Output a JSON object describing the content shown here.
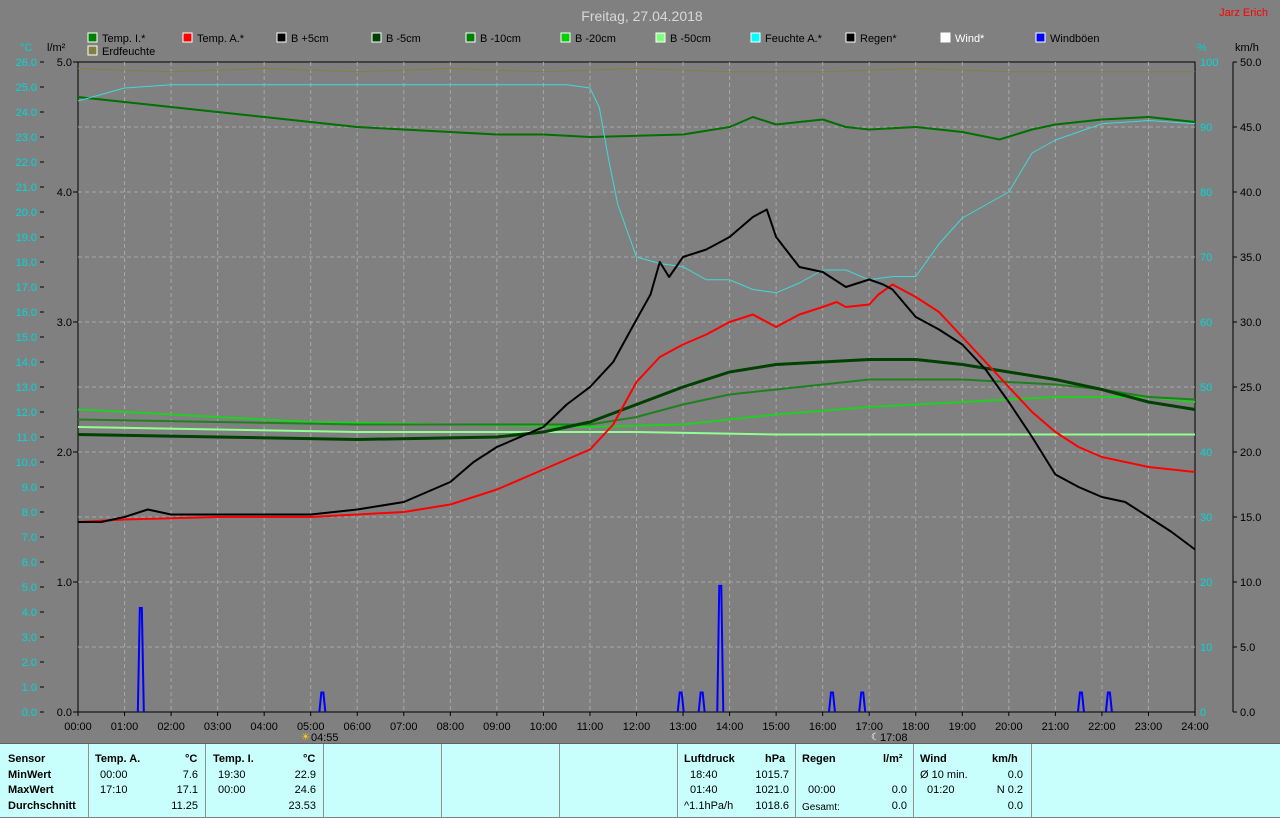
{
  "header": {
    "title": "Freitag, 27.04.2018",
    "author": "Jarz Erich"
  },
  "legend": [
    {
      "label": "Temp. I.*",
      "color": "#008000"
    },
    {
      "label": "Temp. A.*",
      "color": "#ff0000"
    },
    {
      "label": "B +5cm",
      "color": "#000000"
    },
    {
      "label": "B -5cm",
      "color": "#004000"
    },
    {
      "label": "B -10cm",
      "color": "#008000"
    },
    {
      "label": "B -20cm",
      "color": "#00d000"
    },
    {
      "label": "B -50cm",
      "color": "#80ff80"
    },
    {
      "label": "Feuchte A.*",
      "color": "#00ffff"
    },
    {
      "label": "Regen*",
      "color": "#000000"
    },
    {
      "label": "Wind*",
      "color": "#ffffff"
    },
    {
      "label": "Windböen",
      "color": "#0000ff"
    },
    {
      "label": "Erdfeuchte",
      "color": "#808040"
    }
  ],
  "axis_units": {
    "temp": "°C",
    "rain": "l/m²",
    "humidity": "%",
    "wind": "km/h"
  },
  "markers": {
    "sunrise": "04:55",
    "sunset": "17:08"
  },
  "chart_data": {
    "type": "line",
    "x_unit": "hour",
    "xlim": [
      0,
      24
    ],
    "x_ticks": [
      "00:00",
      "01:00",
      "02:00",
      "03:00",
      "04:00",
      "05:00",
      "06:00",
      "07:00",
      "08:00",
      "09:00",
      "10:00",
      "11:00",
      "12:00",
      "13:00",
      "14:00",
      "15:00",
      "16:00",
      "17:00",
      "18:00",
      "19:00",
      "20:00",
      "21:00",
      "22:00",
      "23:00",
      "24:00"
    ],
    "temp_axis": {
      "min": 0,
      "max": 26,
      "step": 1
    },
    "rain_axis": {
      "min": 0,
      "max": 5,
      "ticks": [
        "0.0",
        "1.0",
        "2.0",
        "3.0",
        "4.0",
        "5.0"
      ]
    },
    "humidity_axis": {
      "min": 0,
      "max": 100,
      "ticks": [
        "0",
        "10",
        "20",
        "30",
        "40",
        "50",
        "60",
        "70",
        "80",
        "90",
        "100"
      ]
    },
    "wind_axis": {
      "min": 0,
      "max": 50,
      "ticks": [
        "0.0",
        "5.0",
        "10.0",
        "15.0",
        "20.0",
        "25.0",
        "30.0",
        "35.0",
        "40.0",
        "45.0",
        "50.0"
      ]
    },
    "grid": true,
    "series": [
      {
        "name": "Temp. I.*",
        "axis": "temp",
        "color": "#007000",
        "width": 2,
        "points": [
          [
            0,
            24.6
          ],
          [
            1,
            24.4
          ],
          [
            2,
            24.2
          ],
          [
            3,
            24.0
          ],
          [
            4,
            23.8
          ],
          [
            5,
            23.6
          ],
          [
            6,
            23.4
          ],
          [
            7,
            23.3
          ],
          [
            8,
            23.2
          ],
          [
            9,
            23.1
          ],
          [
            10,
            23.1
          ],
          [
            11,
            23.0
          ],
          [
            12,
            23.05
          ],
          [
            13,
            23.1
          ],
          [
            14,
            23.4
          ],
          [
            14.5,
            23.8
          ],
          [
            15,
            23.5
          ],
          [
            16,
            23.7
          ],
          [
            16.5,
            23.4
          ],
          [
            17,
            23.3
          ],
          [
            18,
            23.4
          ],
          [
            19,
            23.2
          ],
          [
            19.8,
            22.9
          ],
          [
            20.5,
            23.3
          ],
          [
            21,
            23.5
          ],
          [
            22,
            23.7
          ],
          [
            23,
            23.8
          ],
          [
            24,
            23.6
          ]
        ]
      },
      {
        "name": "Feuchte A.*",
        "axis": "humidity",
        "color": "#40d8d8",
        "width": 1,
        "points": [
          [
            0,
            94
          ],
          [
            1,
            96
          ],
          [
            2,
            96.5
          ],
          [
            5,
            96.5
          ],
          [
            8,
            96.5
          ],
          [
            10.5,
            96.5
          ],
          [
            11,
            96
          ],
          [
            11.2,
            93
          ],
          [
            11.4,
            85
          ],
          [
            11.6,
            78
          ],
          [
            12,
            70
          ],
          [
            12.5,
            69
          ],
          [
            13,
            68.5
          ],
          [
            13.5,
            66.5
          ],
          [
            14,
            66.5
          ],
          [
            14.5,
            65
          ],
          [
            15,
            64.5
          ],
          [
            15.5,
            66
          ],
          [
            16,
            68
          ],
          [
            16.5,
            68
          ],
          [
            17,
            66.5
          ],
          [
            17.5,
            67
          ],
          [
            18,
            67
          ],
          [
            18.5,
            72
          ],
          [
            19,
            76
          ],
          [
            20,
            80
          ],
          [
            20.5,
            86
          ],
          [
            21,
            88
          ],
          [
            22,
            90.5
          ],
          [
            23,
            91
          ],
          [
            24,
            90.5
          ]
        ]
      },
      {
        "name": "Erdfeuchte",
        "axis": "humidity",
        "color": "#808040",
        "width": 1,
        "points": [
          [
            0,
            99
          ],
          [
            2,
            98.5
          ],
          [
            4,
            99
          ],
          [
            6,
            98.5
          ],
          [
            8,
            99
          ],
          [
            10,
            98.5
          ],
          [
            12,
            99
          ],
          [
            14,
            98.5
          ],
          [
            16,
            98.5
          ],
          [
            18,
            99
          ],
          [
            20,
            98.5
          ],
          [
            22,
            98.5
          ],
          [
            24,
            98.5
          ]
        ]
      },
      {
        "name": "B -50cm",
        "axis": "temp",
        "color": "#90ff90",
        "width": 2,
        "points": [
          [
            0,
            11.4
          ],
          [
            3,
            11.3
          ],
          [
            6,
            11.2
          ],
          [
            9,
            11.2
          ],
          [
            12,
            11.2
          ],
          [
            15,
            11.1
          ],
          [
            18,
            11.1
          ],
          [
            21,
            11.1
          ],
          [
            24,
            11.1
          ]
        ]
      },
      {
        "name": "B -20cm",
        "axis": "temp",
        "color": "#20d020",
        "width": 2,
        "points": [
          [
            0,
            12.1
          ],
          [
            2,
            11.9
          ],
          [
            5,
            11.6
          ],
          [
            8,
            11.5
          ],
          [
            11,
            11.4
          ],
          [
            13,
            11.5
          ],
          [
            15,
            11.9
          ],
          [
            17,
            12.2
          ],
          [
            19,
            12.4
          ],
          [
            21,
            12.6
          ],
          [
            23,
            12.6
          ],
          [
            24,
            12.4
          ]
        ]
      },
      {
        "name": "B -10cm",
        "axis": "temp",
        "color": "#208020",
        "width": 2,
        "points": [
          [
            0,
            11.7
          ],
          [
            3,
            11.6
          ],
          [
            6,
            11.5
          ],
          [
            9,
            11.5
          ],
          [
            11,
            11.5
          ],
          [
            12,
            11.8
          ],
          [
            13,
            12.3
          ],
          [
            14,
            12.7
          ],
          [
            15,
            12.9
          ],
          [
            16,
            13.1
          ],
          [
            17,
            13.3
          ],
          [
            18,
            13.3
          ],
          [
            19,
            13.3
          ],
          [
            20,
            13.2
          ],
          [
            21,
            13.1
          ],
          [
            22,
            12.9
          ],
          [
            23,
            12.6
          ],
          [
            24,
            12.5
          ]
        ]
      },
      {
        "name": "B -5cm",
        "axis": "temp",
        "color": "#004000",
        "width": 3,
        "points": [
          [
            0,
            11.1
          ],
          [
            3,
            11.0
          ],
          [
            6,
            10.9
          ],
          [
            9,
            11.0
          ],
          [
            10,
            11.2
          ],
          [
            11,
            11.6
          ],
          [
            12,
            12.3
          ],
          [
            13,
            13.0
          ],
          [
            14,
            13.6
          ],
          [
            15,
            13.9
          ],
          [
            16,
            14.0
          ],
          [
            17,
            14.1
          ],
          [
            18,
            14.1
          ],
          [
            19,
            13.9
          ],
          [
            20,
            13.6
          ],
          [
            21,
            13.3
          ],
          [
            22,
            12.9
          ],
          [
            23,
            12.4
          ],
          [
            24,
            12.1
          ]
        ]
      },
      {
        "name": "Temp. A.*",
        "axis": "temp",
        "color": "#ff0000",
        "width": 2,
        "points": [
          [
            0,
            7.6
          ],
          [
            1,
            7.7
          ],
          [
            2,
            7.75
          ],
          [
            3,
            7.8
          ],
          [
            4,
            7.8
          ],
          [
            5,
            7.8
          ],
          [
            6,
            7.9
          ],
          [
            7,
            8.0
          ],
          [
            8,
            8.3
          ],
          [
            9,
            8.9
          ],
          [
            10,
            9.7
          ],
          [
            11,
            10.5
          ],
          [
            11.5,
            11.5
          ],
          [
            12,
            13.2
          ],
          [
            12.5,
            14.2
          ],
          [
            13,
            14.7
          ],
          [
            13.5,
            15.1
          ],
          [
            14,
            15.6
          ],
          [
            14.5,
            15.9
          ],
          [
            15,
            15.4
          ],
          [
            15.5,
            15.9
          ],
          [
            16,
            16.2
          ],
          [
            16.3,
            16.4
          ],
          [
            16.5,
            16.2
          ],
          [
            17,
            16.3
          ],
          [
            17.2,
            16.7
          ],
          [
            17.5,
            17.1
          ],
          [
            18,
            16.6
          ],
          [
            18.5,
            16.0
          ],
          [
            19,
            15.0
          ],
          [
            19.5,
            14.0
          ],
          [
            20,
            13.0
          ],
          [
            20.5,
            12.0
          ],
          [
            21,
            11.2
          ],
          [
            21.5,
            10.6
          ],
          [
            22,
            10.2
          ],
          [
            23,
            9.8
          ],
          [
            24,
            9.6
          ]
        ]
      },
      {
        "name": "B +5cm",
        "axis": "temp",
        "color": "#000000",
        "width": 2,
        "points": [
          [
            0,
            7.6
          ],
          [
            0.5,
            7.6
          ],
          [
            1,
            7.8
          ],
          [
            1.5,
            8.1
          ],
          [
            2,
            7.9
          ],
          [
            3,
            7.9
          ],
          [
            4,
            7.9
          ],
          [
            5,
            7.9
          ],
          [
            6,
            8.1
          ],
          [
            7,
            8.4
          ],
          [
            8,
            9.2
          ],
          [
            8.5,
            10.0
          ],
          [
            9,
            10.6
          ],
          [
            9.5,
            11.0
          ],
          [
            10,
            11.4
          ],
          [
            10.5,
            12.3
          ],
          [
            11,
            13.0
          ],
          [
            11.5,
            14.0
          ],
          [
            12,
            15.7
          ],
          [
            12.3,
            16.7
          ],
          [
            12.5,
            18.0
          ],
          [
            12.7,
            17.4
          ],
          [
            13,
            18.2
          ],
          [
            13.5,
            18.5
          ],
          [
            14,
            19.0
          ],
          [
            14.5,
            19.8
          ],
          [
            14.8,
            20.1
          ],
          [
            15,
            19.0
          ],
          [
            15.5,
            17.8
          ],
          [
            16,
            17.6
          ],
          [
            16.5,
            17.0
          ],
          [
            17,
            17.3
          ],
          [
            17.3,
            17.1
          ],
          [
            17.5,
            16.9
          ],
          [
            18,
            15.8
          ],
          [
            18.5,
            15.3
          ],
          [
            19,
            14.7
          ],
          [
            19.5,
            13.7
          ],
          [
            20,
            12.4
          ],
          [
            20.5,
            11.0
          ],
          [
            21,
            9.5
          ],
          [
            21.5,
            9.0
          ],
          [
            22,
            8.6
          ],
          [
            22.5,
            8.4
          ],
          [
            23,
            7.8
          ],
          [
            23.5,
            7.2
          ],
          [
            24,
            6.5
          ]
        ]
      }
    ],
    "gusts": {
      "name": "Windböen",
      "axis": "wind",
      "color": "#0000ff",
      "events": [
        [
          1.35,
          8.0
        ],
        [
          5.25,
          1.5
        ],
        [
          12.95,
          1.5
        ],
        [
          13.4,
          1.5
        ],
        [
          13.8,
          9.7
        ],
        [
          16.2,
          1.5
        ],
        [
          16.85,
          1.5
        ],
        [
          21.55,
          1.5
        ],
        [
          22.15,
          1.5
        ]
      ]
    },
    "rain": {
      "name": "Regen*",
      "axis": "rain",
      "total": 0.0
    }
  },
  "stats": {
    "row_labels": [
      "Sensor",
      "MinWert",
      "MaxWert",
      "Durchschnitt"
    ],
    "temp_a": {
      "title": "Temp. A.",
      "unit": "°C",
      "min_time": "00:00",
      "min_val": "7.6",
      "max_time": "17:10",
      "max_val": "17.1",
      "avg": "11.25"
    },
    "temp_i": {
      "title": "Temp. I.",
      "unit": "°C",
      "min_time": "19:30",
      "min_val": "22.9",
      "max_time": "00:00",
      "max_val": "24.6",
      "avg": "23.53"
    },
    "pressure": {
      "title": "Luftdruck",
      "unit": "hPa",
      "min_time": "18:40",
      "min_val": "1015.7",
      "max_time": "01:40",
      "max_val": "1021.0",
      "trend": "^1.1hPa/h",
      "avg": "1018.6"
    },
    "rain": {
      "title": "Regen",
      "unit": "l/m²",
      "min_time": "00:00",
      "min_val": "0.0",
      "max_val": "0.0",
      "total_label": "Gesamt:",
      "total_val": "0.0"
    },
    "wind": {
      "title": "Wind",
      "unit": "km/h",
      "avg_label": "Ø 10 min.",
      "avg_val": "0.0",
      "max_time": "01:20",
      "max_val": "N 0.2",
      "total_val": "0.0"
    }
  }
}
